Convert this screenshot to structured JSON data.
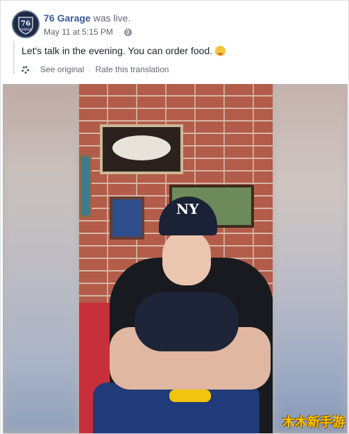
{
  "post": {
    "page_name": "76 Garage",
    "action_text": "was live.",
    "timestamp": "May 11 at 5:15 PM",
    "privacy_icon": "globe-icon",
    "message": "Let's talk in the evening. You can order food.",
    "emoji": "smiling-face-emoji",
    "see_original": "See original",
    "separator": "·",
    "rate_translation": "Rate this translation",
    "settings_icon": "gear-icon"
  },
  "avatar": {
    "logo_text": "76",
    "sub_text": "GARAGE"
  },
  "video": {
    "cap_logo": "NY"
  },
  "watermark": "木木新手游",
  "colors": {
    "link": "#385898",
    "meta": "#606770",
    "text": "#1d2129",
    "watermark": "#f5c400"
  }
}
